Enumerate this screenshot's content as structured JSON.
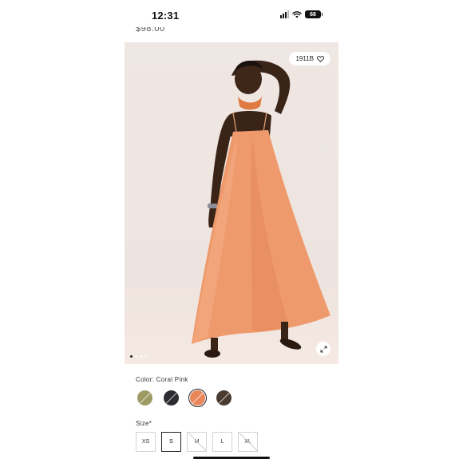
{
  "status_bar": {
    "time": "12:31",
    "battery": "68"
  },
  "price": "$98.00",
  "product_image": {
    "favorites_count": "1911B",
    "carousel_dots": 4,
    "active_dot": 0
  },
  "color": {
    "label": "Color: Coral Pink",
    "swatches": [
      {
        "name": "sage",
        "color": "#9d9a63",
        "selected": false
      },
      {
        "name": "black",
        "color": "#2c2d30",
        "selected": false
      },
      {
        "name": "coral-pink",
        "color": "#e9865a",
        "selected": true
      },
      {
        "name": "brown",
        "color": "#4a3b30",
        "selected": false
      }
    ]
  },
  "size": {
    "label": "Size*",
    "options": [
      {
        "label": "XS",
        "selected": false,
        "unavailable": false
      },
      {
        "label": "S",
        "selected": true,
        "unavailable": false
      },
      {
        "label": "M",
        "selected": false,
        "unavailable": true
      },
      {
        "label": "L",
        "selected": false,
        "unavailable": false
      },
      {
        "label": "XL",
        "selected": false,
        "unavailable": true
      }
    ]
  }
}
